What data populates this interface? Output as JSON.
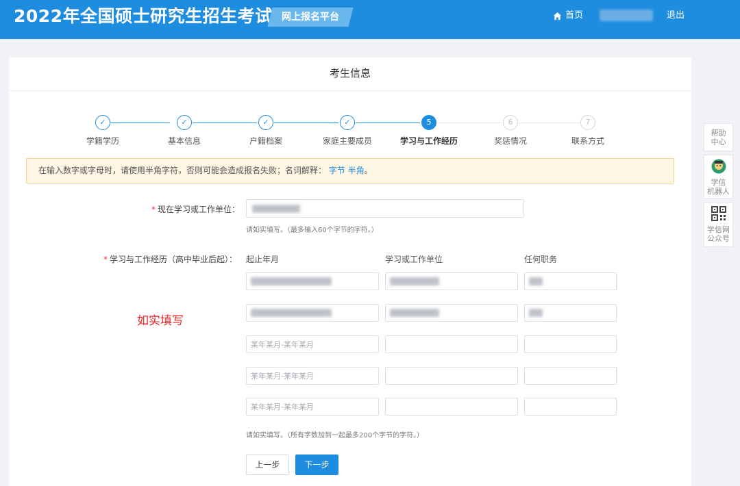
{
  "header": {
    "site_title": "2022年全国硕士研究生招生考试",
    "platform_tag": "网上报名平台",
    "home_label": "首页",
    "logout_label": "退出"
  },
  "panel": {
    "title": "考生信息"
  },
  "steps": [
    {
      "num": "✓",
      "label": "学籍学历",
      "state": "done"
    },
    {
      "num": "✓",
      "label": "基本信息",
      "state": "done"
    },
    {
      "num": "✓",
      "label": "户籍档案",
      "state": "done"
    },
    {
      "num": "✓",
      "label": "家庭主要成员",
      "state": "done"
    },
    {
      "num": "5",
      "label": "学习与工作经历",
      "state": "active"
    },
    {
      "num": "6",
      "label": "奖惩情况",
      "state": "todo"
    },
    {
      "num": "7",
      "label": "联系方式",
      "state": "todo"
    }
  ],
  "notice": {
    "text": "在输入数字或字母时，请使用半角字符，否则可能会造成报名失败；名词解释：",
    "link1": "字节",
    "link2": "半角",
    "end": "。"
  },
  "form": {
    "current_unit": {
      "required_mark": "*",
      "label": "现在学习或工作单位：",
      "hint": "请如实填写。（最多输入60个字节的字符。）"
    },
    "history": {
      "required_mark": "*",
      "label": "学习与工作经历（高中毕业后起）：",
      "columns": [
        "起止年月",
        "学习或工作单位",
        "任何职务"
      ],
      "placeholder": "某年某月-某年某月",
      "hint": "请如实填写。（所有字数加到一起最多200个字节的字符。）"
    },
    "annotation": "如实填写"
  },
  "buttons": {
    "prev": "上一步",
    "next": "下一步"
  },
  "sidebar": {
    "help_line1": "帮助",
    "help_line2": "中心",
    "robot_line1": "学信",
    "robot_line2": "机器人",
    "qr_line1": "学信网",
    "qr_line2": "公众号"
  },
  "colors": {
    "primary": "#1f8ddf",
    "required": "#e33333",
    "annotation": "#e22222",
    "notice_bg": "#fdf6e4",
    "notice_border": "#f3d48a"
  }
}
